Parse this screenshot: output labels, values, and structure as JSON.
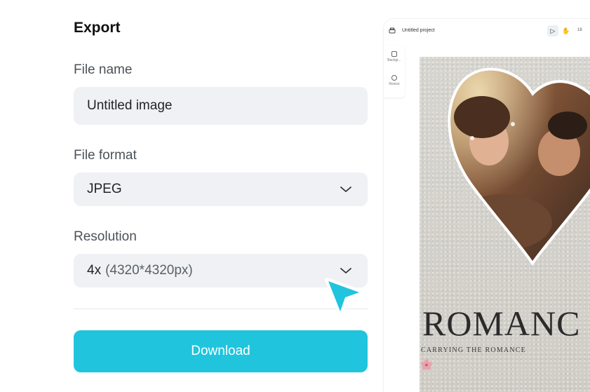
{
  "export_panel": {
    "title": "Export",
    "file_name": {
      "label": "File name",
      "value": "Untitled image"
    },
    "file_format": {
      "label": "File format",
      "value": "JPEG"
    },
    "resolution": {
      "label": "Resolution",
      "value_strong": "4x",
      "value_detail": "(4320*4320px)"
    },
    "download_label": "Download"
  },
  "preview": {
    "project_name": "Untitled project",
    "zoom": "16",
    "rail_items": [
      "Backgr...",
      "Resize"
    ],
    "poster_title": "ROMANC",
    "poster_tagline": "CARRYING THE ROMANCE"
  },
  "colors": {
    "accent": "#20c4dd",
    "field_bg": "#eff1f4",
    "heart_border": "#ffffff"
  },
  "icons": [
    "chevron-down-icon",
    "cursor-pointer-icon",
    "printer-icon",
    "pointer-tool-icon",
    "hand-tool-icon",
    "background-icon",
    "resize-icon",
    "flower-icon"
  ]
}
